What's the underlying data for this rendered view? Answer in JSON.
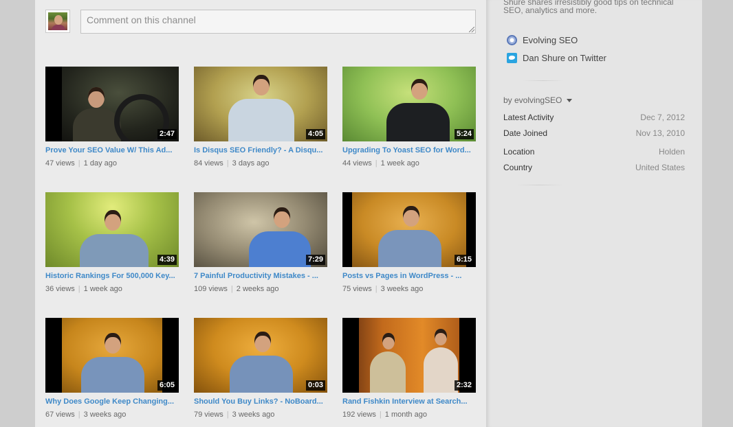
{
  "comment": {
    "placeholder": "Comment on this channel"
  },
  "videos": [
    {
      "title": "Prove Your SEO Value W/ This Ad...",
      "duration": "2:47",
      "views": "47 views",
      "age": "1 day ago"
    },
    {
      "title": "Is Disqus SEO Friendly? - A Disqu...",
      "duration": "4:05",
      "views": "84 views",
      "age": "3 days ago"
    },
    {
      "title": "Upgrading To Yoast SEO for Word...",
      "duration": "5:24",
      "views": "44 views",
      "age": "1 week ago"
    },
    {
      "title": "Historic Rankings For 500,000 Key...",
      "duration": "4:39",
      "views": "36 views",
      "age": "1 week ago"
    },
    {
      "title": "7 Painful Productivity Mistakes - ...",
      "duration": "7:29",
      "views": "109 views",
      "age": "2 weeks ago"
    },
    {
      "title": "Posts vs Pages in WordPress - ...",
      "duration": "6:15",
      "views": "75 views",
      "age": "3 weeks ago"
    },
    {
      "title": "Why Does Google Keep Changing...",
      "duration": "6:05",
      "views": "67 views",
      "age": "3 weeks ago"
    },
    {
      "title": "Should You Buy Links? - NoBoard...",
      "duration": "0:03",
      "views": "79 views",
      "age": "3 weeks ago"
    },
    {
      "title": "Rand Fishkin Interview at Search...",
      "duration": "2:32",
      "views": "192 views",
      "age": "1 month ago"
    }
  ],
  "sidebar": {
    "description": "Shure shares irresistibly good tips on technical SEO, analytics and more.",
    "links": [
      {
        "label": "Evolving SEO",
        "icon": "globe-icon"
      },
      {
        "label": "Dan Shure on Twitter",
        "icon": "twitter-icon"
      }
    ],
    "byline": "by evolvingSEO",
    "info": [
      {
        "key": "Latest Activity",
        "value": "Dec 7, 2012"
      },
      {
        "key": "Date Joined",
        "value": "Nov 13, 2010"
      },
      {
        "key": "Location",
        "value": "Holden"
      },
      {
        "key": "Country",
        "value": "United States"
      }
    ]
  },
  "colors": {
    "link_blue": "#3f89c8",
    "main_bg": "#ebebeb",
    "side_bg": "#e5e5e5",
    "outer_bg": "#cecece"
  }
}
